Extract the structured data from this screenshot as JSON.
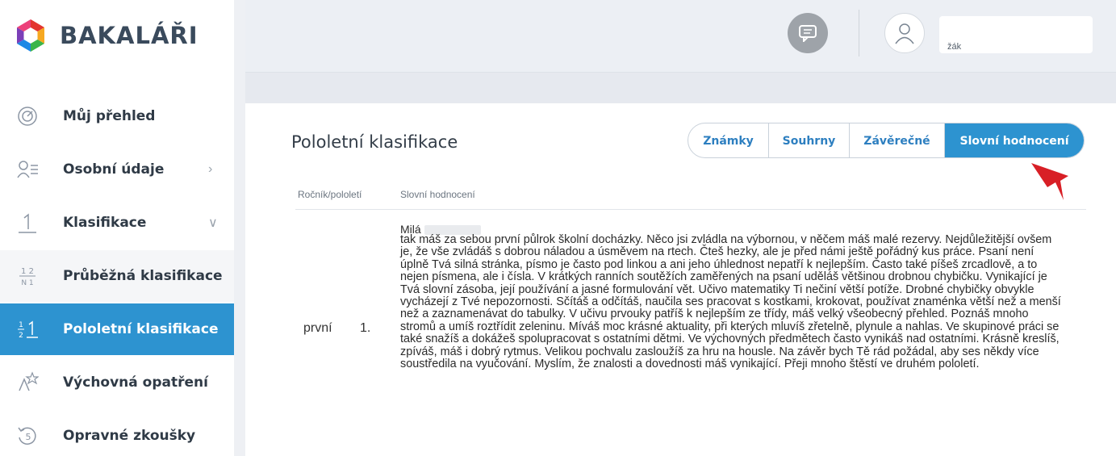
{
  "app": {
    "brand": "BAKALÁŘI",
    "accent_color": "#2d93d0"
  },
  "sidebar": {
    "items": [
      {
        "label": "Můj přehled",
        "icon": "dashboard-gauge-icon"
      },
      {
        "label": "Osobní údaje",
        "icon": "personal-data-icon"
      },
      {
        "label": "Klasifikace",
        "icon": "grade-one-icon"
      },
      {
        "label": "Průběžná klasifikace",
        "icon": "fraction-icon"
      },
      {
        "label": "Pololetní klasifikace",
        "icon": "half-fraction-icon"
      },
      {
        "label": "Výchovná opatření",
        "icon": "award-icon"
      },
      {
        "label": "Opravné zkoušky",
        "icon": "retake-exam-icon"
      }
    ]
  },
  "header": {
    "user_role": "žák",
    "chat_icon": "chat-icon",
    "avatar_icon": "user-icon"
  },
  "main": {
    "title": "Pololetní klasifikace",
    "tabs": [
      {
        "label": "Známky",
        "active": false
      },
      {
        "label": "Souhrny",
        "active": false
      },
      {
        "label": "Závěrečné",
        "active": false
      },
      {
        "label": "Slovní hodnocení",
        "active": true
      }
    ],
    "table": {
      "columns": [
        "Ročník/pololetí",
        "Slovní hodnocení"
      ],
      "rows": [
        {
          "year": "první",
          "term": "1.",
          "greeting": "Milá",
          "text": "tak máš za sebou první půlrok školní docházky. Něco jsi zvládla na výbornou, v něčem máš malé rezervy. Nejdůležitější ovšem je, že vše zvládáš s dobrou náladou a úsměvem na rtech. Čteš hezky, ale je před námi ještě pořádný kus práce. Psaní není úplně Tvá silná stránka, písmo je často pod linkou a ani jeho úhlednost nepatří k nejlepším. Často také píšeš zrcadlově, a to nejen písmena, ale i čísla. V krátkých ranních soutěžích zaměřených na psaní uděláš většinou drobnou chybičku. Vynikající je Tvá slovní zásoba, její používání a jasné formulování vět. Učivo matematiky Ti nečiní větší potíže. Drobné chybičky obvykle vycházejí z Tvé nepozornosti. Sčítáš a odčítáš, naučila ses pracovat s kostkami, krokovat, používat znaménka větší než a menší než a zaznamenávat do tabulky. V učivu prvouky patříš k nejlepším ze třídy, máš velký všeobecný přehled. Poznáš mnoho stromů a umíš roztřídit zeleninu. Míváš moc krásné aktuality, při kterých mluvíš zřetelně, plynule a nahlas. Ve skupinové práci se také snažíš a dokážeš spolupracovat s ostatními dětmi. Ve výchovných předmětech často vynikáš nad ostatními. Krásně kreslíš, zpíváš, máš i dobrý rytmus. Velikou pochvalu zasloužíš za hru na housle. Na závěr bych Tě rád požádal, aby ses někdy více soustředila na vyučování. Myslím, že znalosti a dovednosti máš vynikající. Přeji mnoho štěstí ve druhém pololetí."
        }
      ]
    }
  }
}
